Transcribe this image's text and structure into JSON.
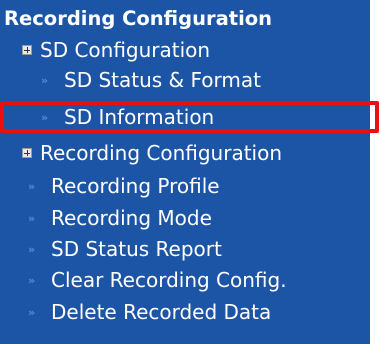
{
  "menu": {
    "heading": "Recording Configuration",
    "items": [
      {
        "label": "SD Configuration",
        "marker": "plus-box-icon"
      },
      {
        "label": "SD Status & Format",
        "marker": "double-chevron-icon"
      },
      {
        "label": "SD Information",
        "marker": "double-chevron-icon",
        "highlighted": true
      },
      {
        "label": "Recording Configuration",
        "marker": "plus-box-icon"
      },
      {
        "label": "Recording Profile",
        "marker": "double-chevron-icon"
      },
      {
        "label": "Recording Mode",
        "marker": "double-chevron-icon"
      },
      {
        "label": "SD Status Report",
        "marker": "double-chevron-icon"
      },
      {
        "label": "Clear Recording Config.",
        "marker": "double-chevron-icon"
      },
      {
        "label": "Delete Recorded Data",
        "marker": "double-chevron-icon"
      }
    ]
  },
  "colors": {
    "panel_background": "#1d55a6",
    "text": "#ffffff",
    "chevron": "#4d8fe0",
    "highlight_border": "#e81010"
  }
}
